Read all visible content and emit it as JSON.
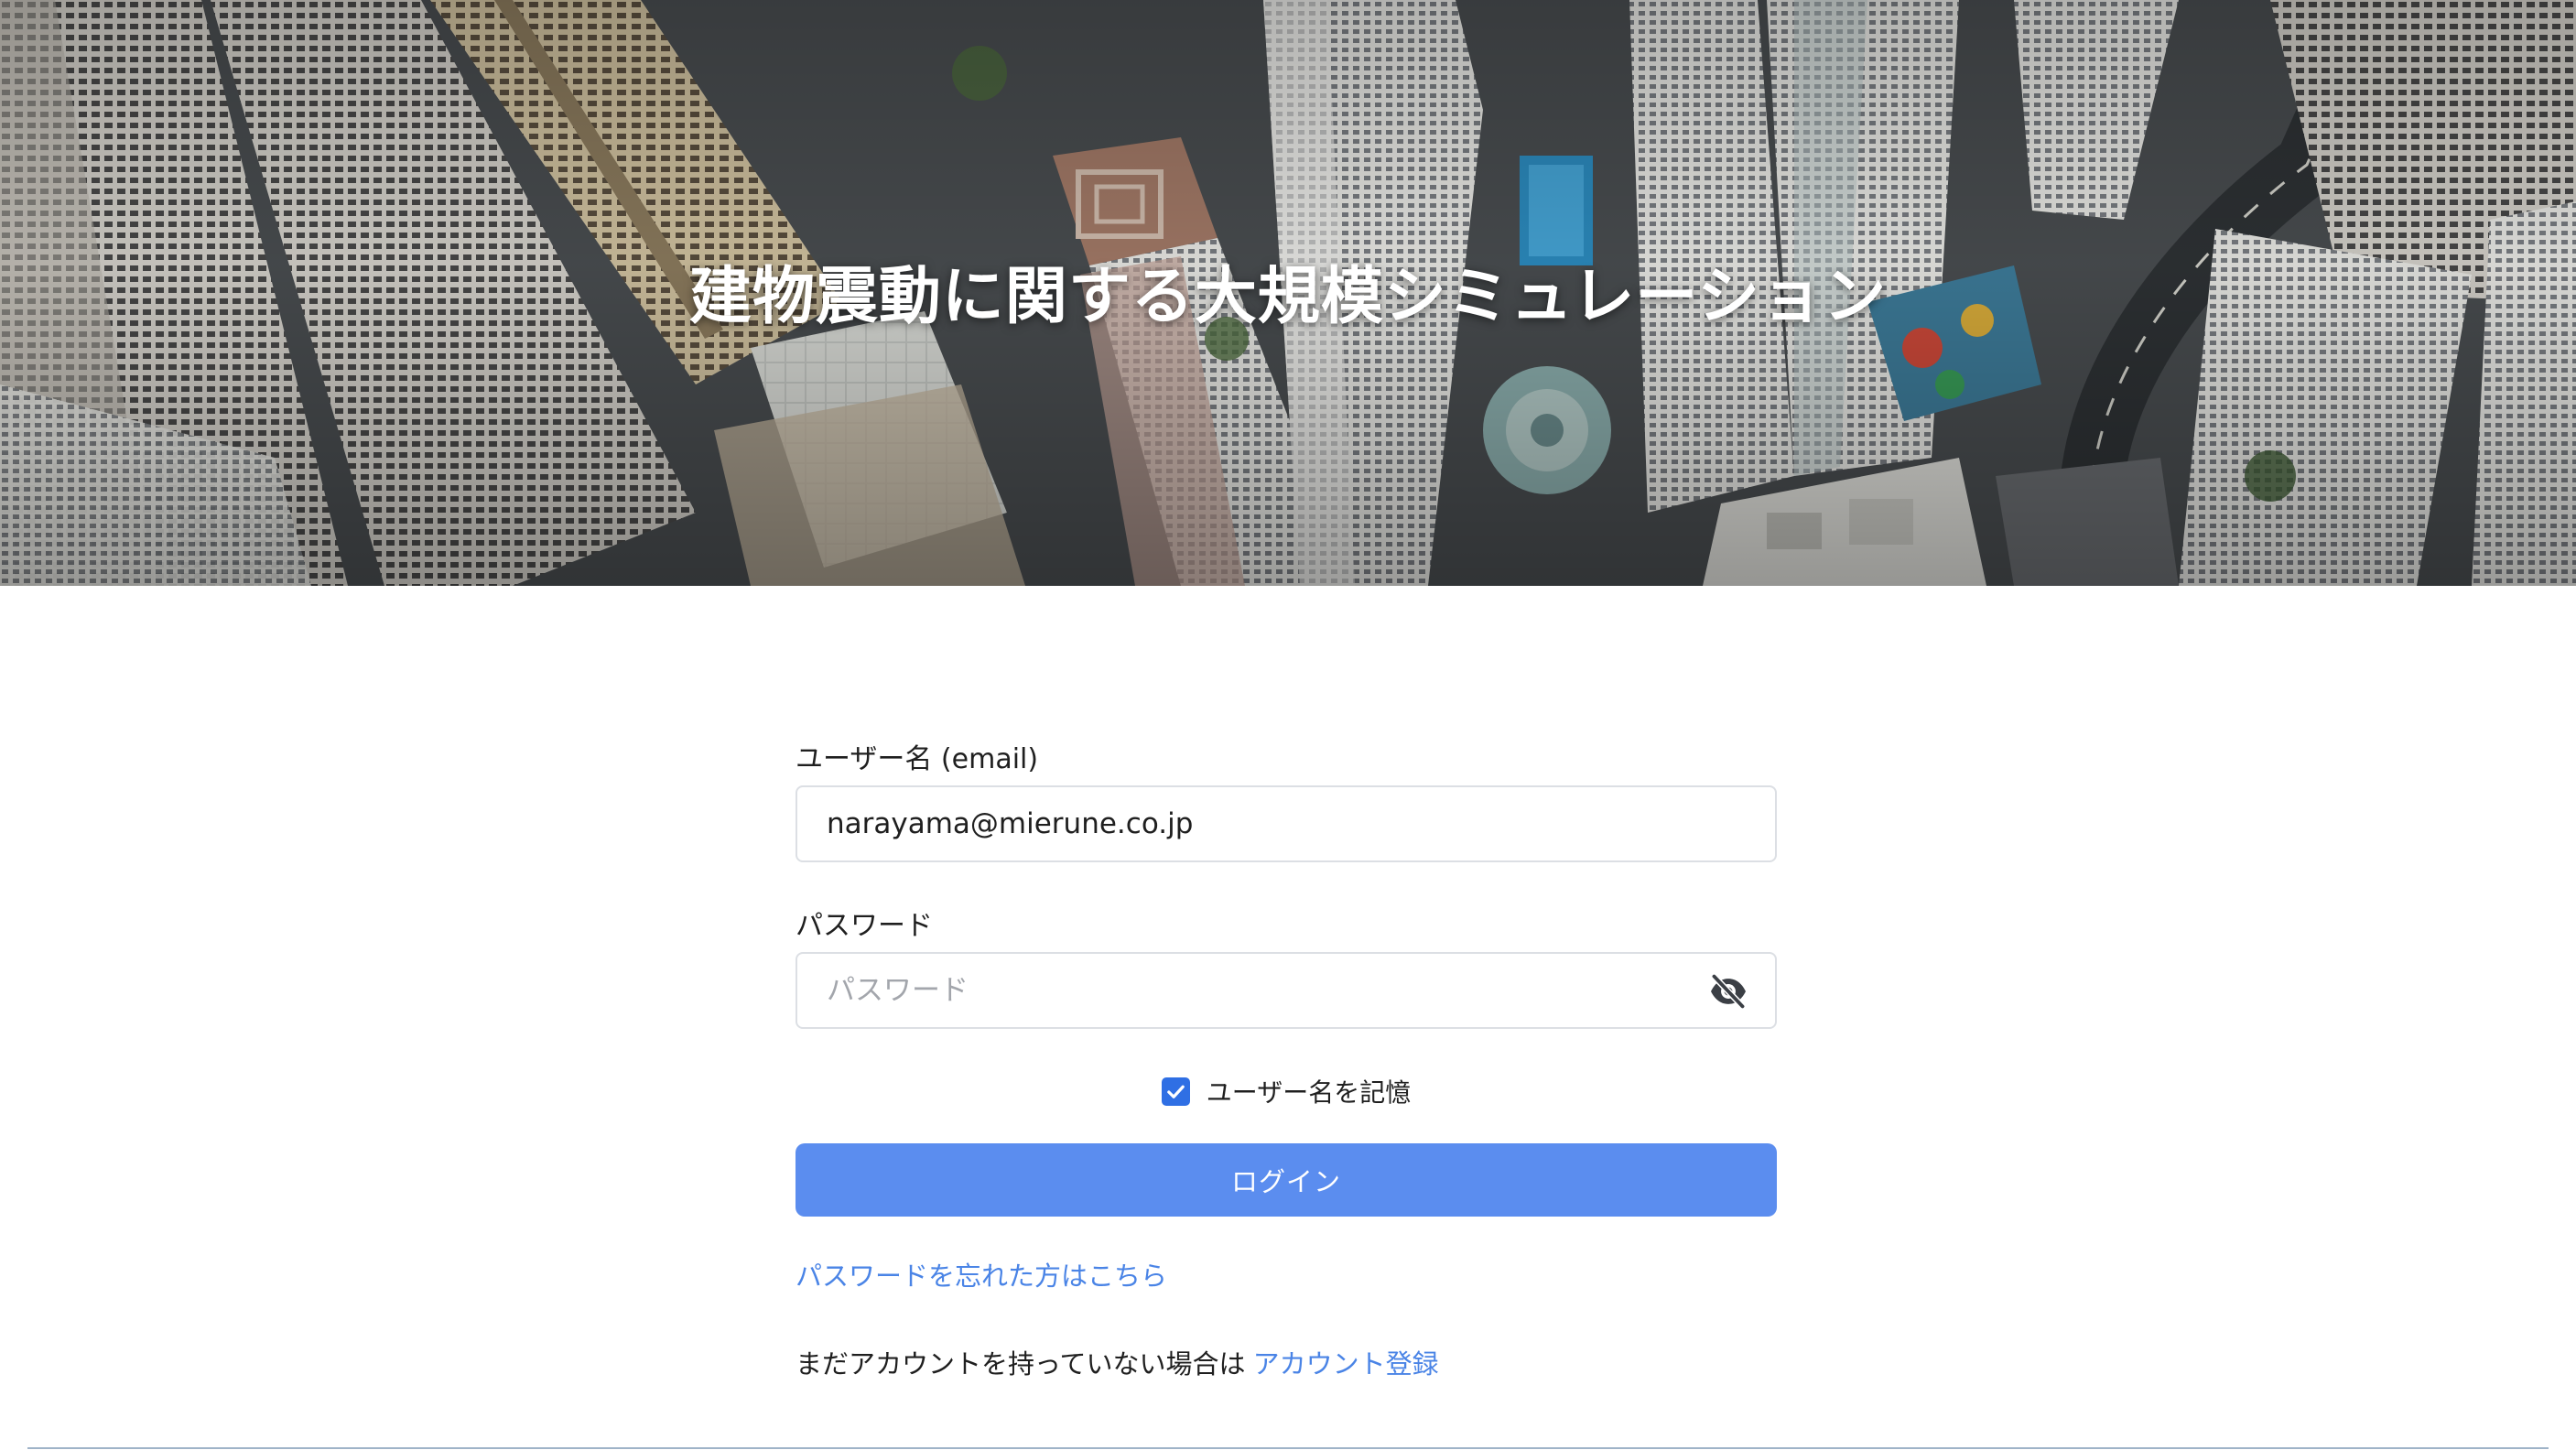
{
  "hero": {
    "title": "建物震動に関する大規模シミュレーション"
  },
  "form": {
    "username": {
      "label": "ユーザー名 (email)",
      "value": "narayama@mierune.co.jp"
    },
    "password": {
      "label": "パスワード",
      "placeholder": "パスワード",
      "toggle_icon": "eye-slash-icon"
    },
    "remember": {
      "label": "ユーザー名を記憶",
      "checked": true
    },
    "login_button": "ログイン",
    "forgot_password": "パスワードを忘れた方はこちら",
    "signup": {
      "prompt": "まだアカウントを持っていない場合は",
      "link": "アカウント登録"
    }
  },
  "colors": {
    "primary_button": "#5b8def",
    "link": "#4a84e6",
    "checkbox": "#2f6fe4",
    "input_border": "#dcdfe4"
  }
}
